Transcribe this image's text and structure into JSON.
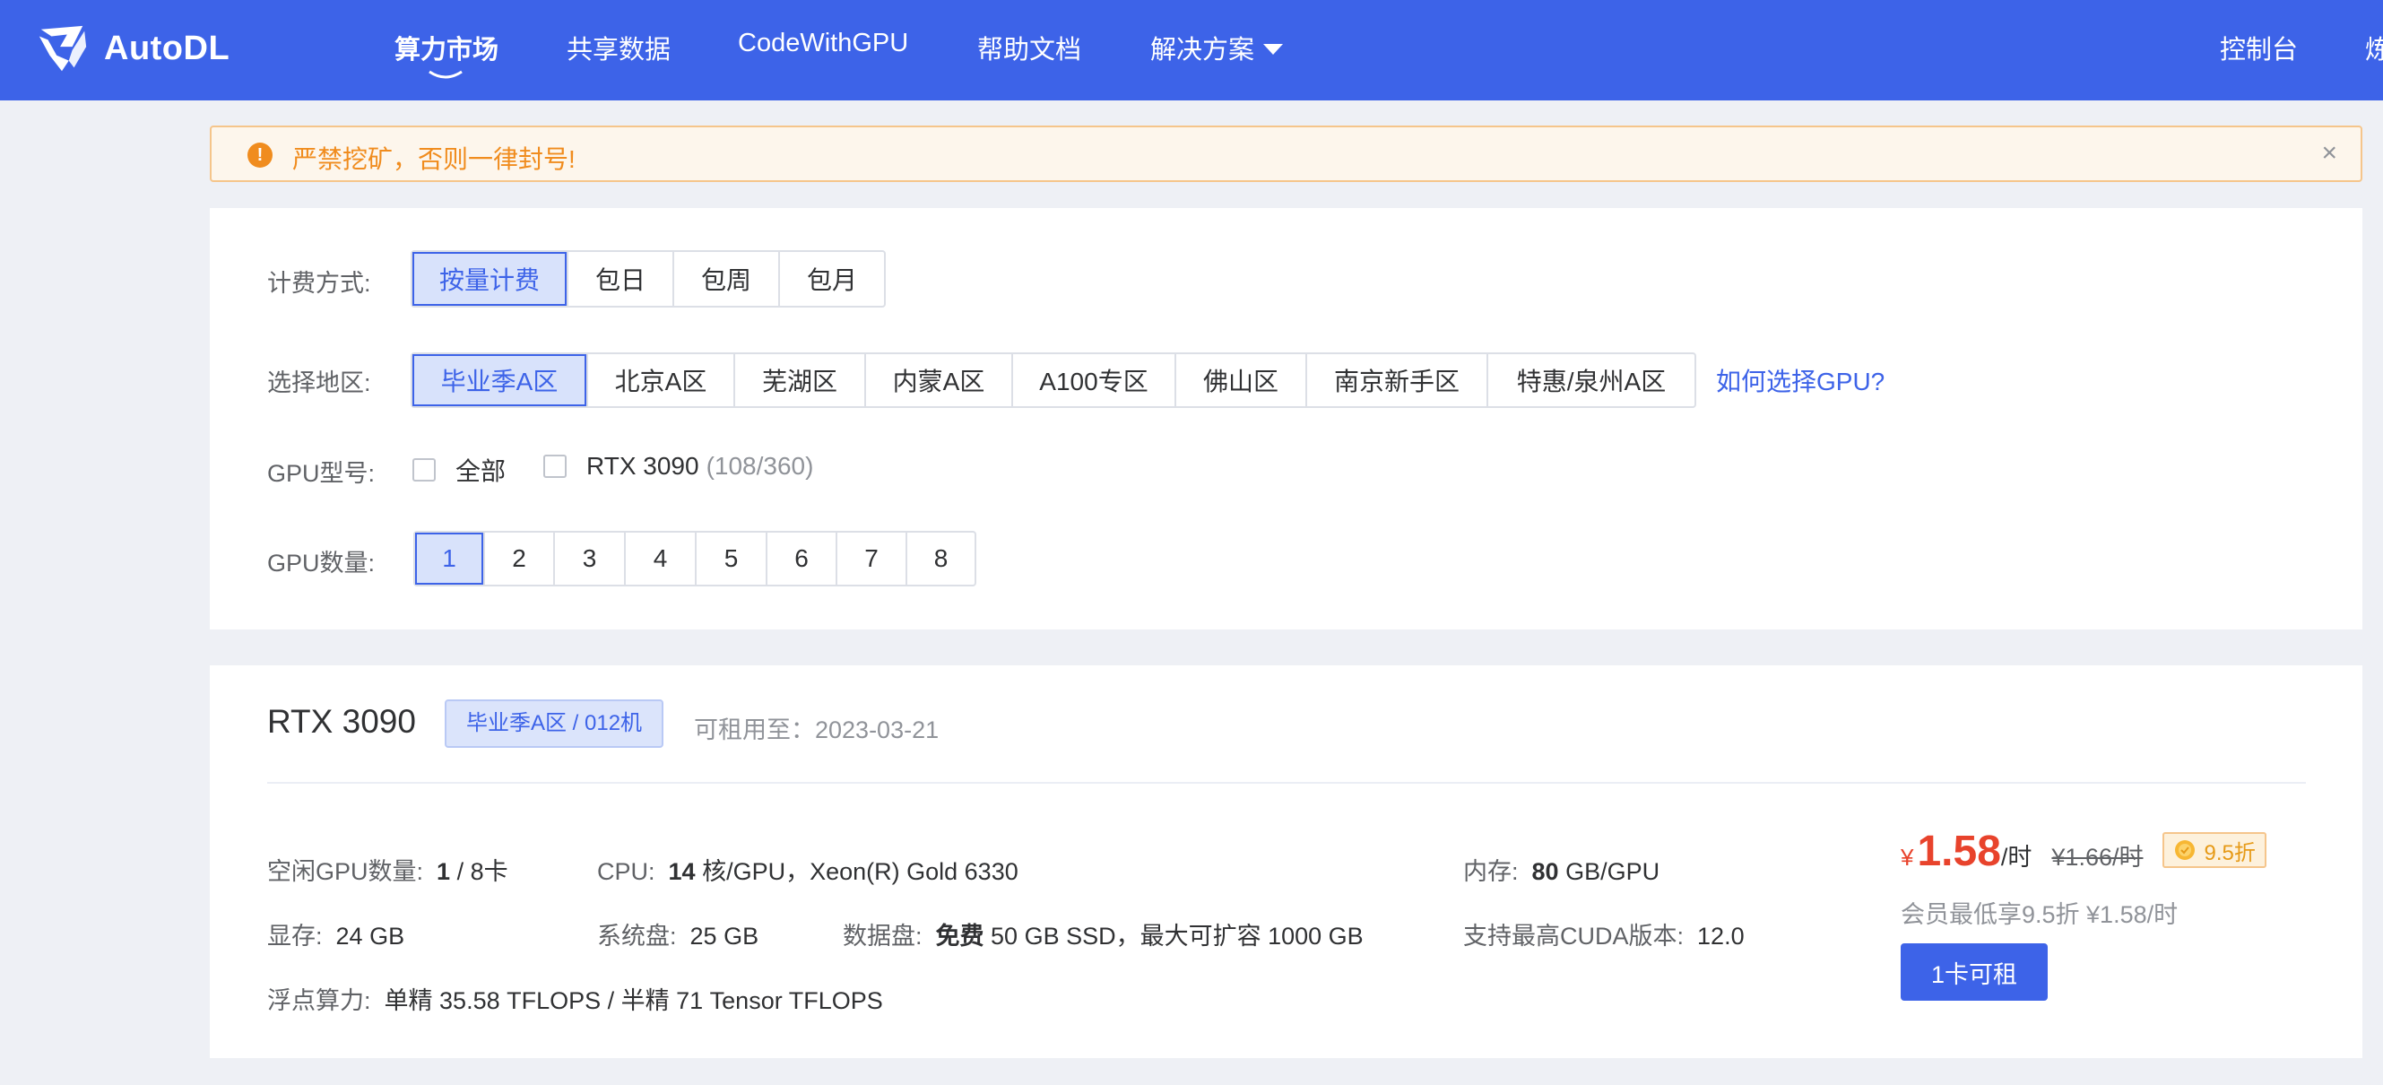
{
  "nav": {
    "brand": "AutoDL",
    "items": [
      {
        "label": "算力市场",
        "active": true
      },
      {
        "label": "共享数据"
      },
      {
        "label": "CodeWithGPU"
      },
      {
        "label": "帮助文档"
      },
      {
        "label": "解决方案"
      }
    ],
    "console": "控制台",
    "overflow": "炼"
  },
  "alert": {
    "icon": "!",
    "text": "严禁挖矿，否则一律封号!",
    "close": "×"
  },
  "filters": {
    "billing": {
      "label": "计费方式:",
      "options": [
        "按量计费",
        "包日",
        "包周",
        "包月"
      ],
      "selected": "按量计费"
    },
    "region": {
      "label": "选择地区:",
      "options": [
        "毕业季A区",
        "北京A区",
        "芜湖区",
        "内蒙A区",
        "A100专区",
        "佛山区",
        "南京新手区",
        "特惠/泉州A区"
      ],
      "selected": "毕业季A区",
      "help": "如何选择GPU?"
    },
    "gpu_model": {
      "label": "GPU型号:",
      "all": "全部",
      "model": "RTX 3090",
      "count": "(108/360)"
    },
    "gpu_count": {
      "label": "GPU数量:",
      "options": [
        "1",
        "2",
        "3",
        "4",
        "5",
        "6",
        "7",
        "8"
      ],
      "selected": "1"
    }
  },
  "product": {
    "title": "RTX 3090",
    "zone_tag": "毕业季A区 / 012机",
    "rent_until": "可租用至：2023-03-21",
    "specs": {
      "idle_label": "空闲GPU数量:",
      "idle_free": "1",
      "idle_total": " / 8卡",
      "cpu_label": "CPU:",
      "cpu_cores": "14",
      "cpu_rest": " 核/GPU，Xeon(R) Gold 6330",
      "mem_label": "内存:",
      "mem_value": "80",
      "mem_unit": " GB/GPU",
      "vram_label": "显存:",
      "vram_value": "24 GB",
      "sysdisk_label": "系统盘:",
      "sysdisk_value": "25 GB",
      "datadisk_label": "数据盘:",
      "datadisk_free": "免费",
      "datadisk_rest": " 50 GB SSD，最大可扩容 1000 GB",
      "cuda_label": "支持最高CUDA版本:",
      "cuda_value": "12.0",
      "flops_label": "浮点算力:",
      "flops_value": "单精 35.58 TFLOPS / 半精 71 Tensor TFLOPS"
    },
    "price": {
      "currency": "¥",
      "value": "1.58",
      "unit": "/时",
      "original": "¥1.66/时",
      "discount": "9.5折",
      "member": "会员最低享9.5折 ¥1.58/时"
    },
    "rent_button": "1卡可租"
  },
  "colors": {
    "brand": "#3d63e8",
    "price": "#e8432c",
    "warning": "#f08c1e"
  }
}
